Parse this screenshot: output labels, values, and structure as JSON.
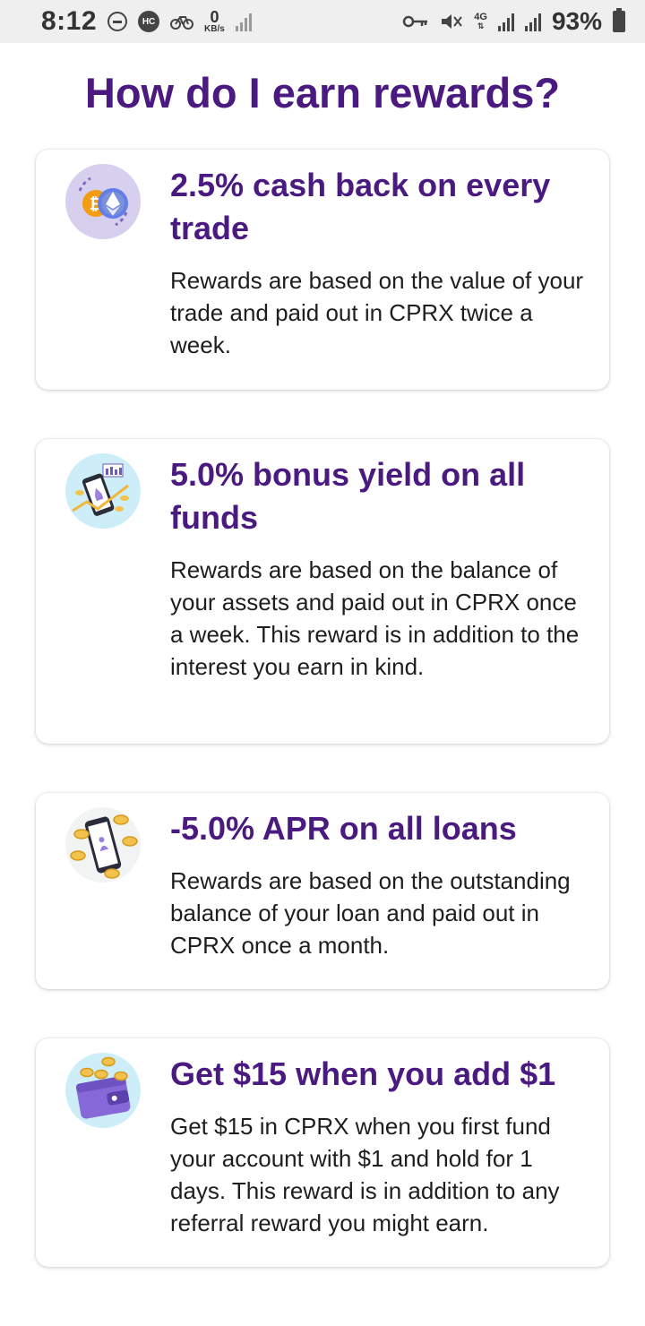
{
  "status_bar": {
    "time": "8:12",
    "hc_badge": "HC",
    "speed_value": "0",
    "speed_unit": "KB/s",
    "network": "4G",
    "battery_percent": "93%"
  },
  "page": {
    "title": "How do I earn rewards?"
  },
  "cards": [
    {
      "title": "2.5% cash back on every trade",
      "description": "Rewards are based on the value of your trade and paid out in CPRX twice a week.",
      "icon": "crypto-coins-icon"
    },
    {
      "title": "5.0% bonus yield on all funds",
      "description": "Rewards are based on the balance of your assets and paid out in CPRX once a week. This reward is in addition to the interest you earn in kind.",
      "icon": "phone-growth-icon"
    },
    {
      "title": "-5.0% APR on all loans",
      "description": "Rewards are based on the outstanding balance of your loan and paid out in CPRX once a month.",
      "icon": "phone-coins-icon"
    },
    {
      "title": "Get $15 when you add $1",
      "description": "Get $15 in CPRX when you first fund your account with $1 and hold for 1 days. This reward is in addition to any referral reward you might earn.",
      "icon": "wallet-coins-icon"
    }
  ],
  "colors": {
    "brand_purple": "#4a1a80",
    "text_dark": "#1e1e1e",
    "status_bar_bg": "#efefef"
  }
}
